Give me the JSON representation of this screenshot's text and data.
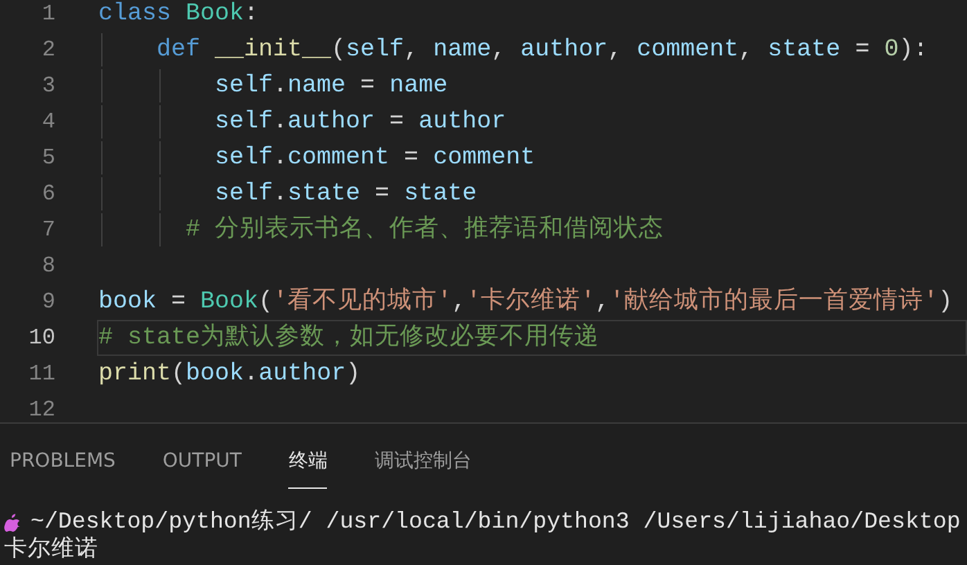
{
  "editor": {
    "lines": [
      {
        "number": "1",
        "current": false,
        "tokens": [
          {
            "kind": "keyword",
            "text": "class"
          },
          {
            "kind": "type",
            "text": "Book"
          },
          {
            "kind": "plain",
            "text": ":"
          }
        ],
        "children": [
          {
            "number": "2",
            "current": false,
            "tokens": [
              {
                "kind": "keyword",
                "text": "def"
              },
              {
                "kind": "function",
                "text": "__init__"
              },
              {
                "kind": "plain",
                "text": "("
              },
              {
                "kind": "variable",
                "text": "self"
              },
              {
                "kind": "plain",
                "text": ","
              },
              {
                "kind": "variable",
                "text": "name"
              },
              {
                "kind": "plain",
                "text": ","
              },
              {
                "kind": "variable",
                "text": "author"
              },
              {
                "kind": "plain",
                "text": ","
              },
              {
                "kind": "variable",
                "text": "comment"
              },
              {
                "kind": "plain",
                "text": ","
              },
              {
                "kind": "variable",
                "text": "state"
              },
              {
                "kind": "plain",
                "text": "="
              },
              {
                "kind": "number",
                "text": "0"
              },
              {
                "kind": "plain",
                "text": "):"
              }
            ],
            "children": [
              {
                "number": "3",
                "current": false,
                "tokens": [
                  {
                    "kind": "variable",
                    "text": "self"
                  },
                  {
                    "kind": "plain",
                    "text": "."
                  },
                  {
                    "kind": "variable",
                    "text": "name"
                  },
                  {
                    "kind": "plain",
                    "text": "="
                  },
                  {
                    "kind": "variable",
                    "text": "name"
                  }
                ]
              },
              {
                "number": "4",
                "current": false,
                "tokens": [
                  {
                    "kind": "variable",
                    "text": "self"
                  },
                  {
                    "kind": "plain",
                    "text": "."
                  },
                  {
                    "kind": "variable",
                    "text": "author"
                  },
                  {
                    "kind": "plain",
                    "text": "="
                  },
                  {
                    "kind": "variable",
                    "text": "author"
                  }
                ]
              },
              {
                "number": "5",
                "current": false,
                "tokens": [
                  {
                    "kind": "variable",
                    "text": "self"
                  },
                  {
                    "kind": "plain",
                    "text": "."
                  },
                  {
                    "kind": "variable",
                    "text": "comment"
                  },
                  {
                    "kind": "plain",
                    "text": "="
                  },
                  {
                    "kind": "variable",
                    "text": "comment"
                  }
                ]
              },
              {
                "number": "6",
                "current": false,
                "tokens": [
                  {
                    "kind": "variable",
                    "text": "self"
                  },
                  {
                    "kind": "plain",
                    "text": "."
                  },
                  {
                    "kind": "variable",
                    "text": "state"
                  },
                  {
                    "kind": "plain",
                    "text": "="
                  },
                  {
                    "kind": "variable",
                    "text": "state"
                  }
                ]
              },
              {
                "number": "7",
                "current": false,
                "tokens": [
                  {
                    "kind": "comment",
                    "text": "# 分别表示书名、作者、推荐语和借阅状态"
                  }
                ]
              }
            ]
          }
        ]
      },
      {
        "number": "8",
        "current": false
      },
      {
        "number": "9",
        "current": false,
        "tokens": [
          {
            "kind": "variable",
            "text": "book"
          },
          {
            "kind": "plain",
            "text": "="
          },
          {
            "kind": "type",
            "text": "Book"
          },
          {
            "kind": "plain",
            "text": "("
          },
          {
            "kind": "string",
            "text": "'看不见的城市'"
          },
          {
            "kind": "plain",
            "text": ","
          },
          {
            "kind": "string",
            "text": "'卡尔维诺'"
          },
          {
            "kind": "plain",
            "text": ","
          },
          {
            "kind": "string",
            "text": "'献给城市的最后一首爱情诗'"
          },
          {
            "kind": "plain",
            "text": ")"
          }
        ]
      },
      {
        "number": "10",
        "current": true,
        "tokens": [
          {
            "kind": "comment",
            "text": "# state为默认参数，如无修改必要不用传递"
          }
        ]
      },
      {
        "number": "11",
        "current": false,
        "tokens": [
          {
            "kind": "function",
            "text": "print"
          },
          {
            "kind": "plain",
            "text": "("
          },
          {
            "kind": "variable",
            "text": "book"
          },
          {
            "kind": "plain",
            "text": "."
          },
          {
            "kind": "variable",
            "text": "author"
          },
          {
            "kind": "plain",
            "text": ")"
          }
        ]
      },
      {
        "number": "12",
        "current": false
      }
    ]
  },
  "panel": {
    "tabs": [
      {
        "label": "PROBLEMS",
        "selected": false
      },
      {
        "label": "OUTPUT",
        "selected": false
      },
      {
        "label": "终端",
        "selected": true
      },
      {
        "label": "调试控制台",
        "selected": false
      }
    ],
    "terminal": {
      "prompt": "~/Desktop/python练习/ /usr/local/bin/python3 /Users/lijiahao/Desktop",
      "output": "卡尔维诺"
    }
  }
}
